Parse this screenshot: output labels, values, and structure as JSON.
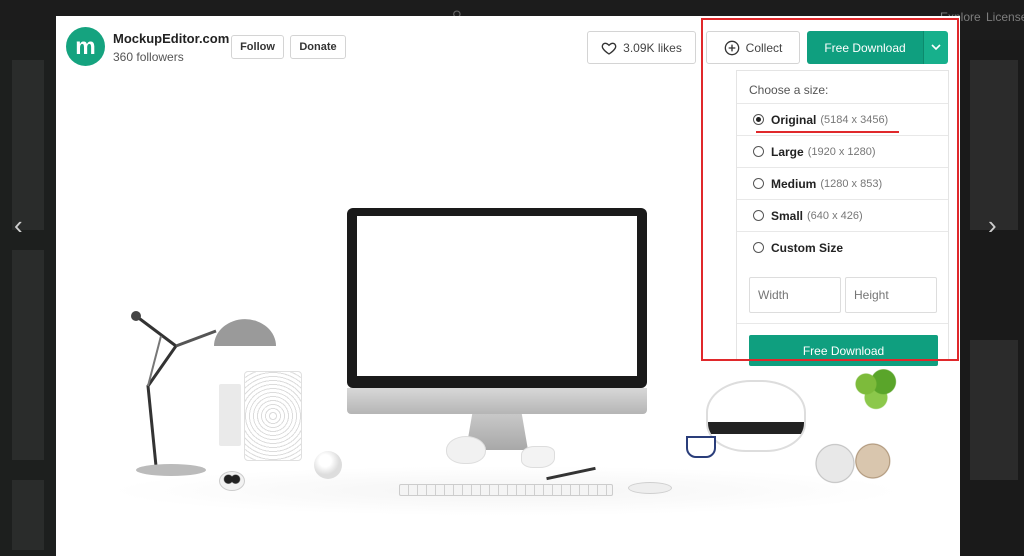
{
  "background": {
    "top_right_items": [
      "Explore",
      "License"
    ],
    "left_arrow": "‹",
    "right_arrow": "›"
  },
  "author": {
    "avatar_letter": "m",
    "name": "MockupEditor.com",
    "followers": "360 followers",
    "follow_label": "Follow",
    "donate_label": "Donate"
  },
  "actions": {
    "likes_label": "3.09K likes",
    "collect_label": "Collect",
    "download_label": "Free Download",
    "caret_icon": "chevron-down-icon"
  },
  "download_menu": {
    "title": "Choose a size:",
    "sizes": [
      {
        "label": "Original",
        "dimensions": "(5184 x 3456)",
        "selected": true
      },
      {
        "label": "Large",
        "dimensions": "(1920 x 1280)",
        "selected": false
      },
      {
        "label": "Medium",
        "dimensions": "(1280 x 853)",
        "selected": false
      },
      {
        "label": "Small",
        "dimensions": "(640 x 426)",
        "selected": false
      }
    ],
    "custom_label": "Custom Size",
    "width_placeholder": "Width",
    "height_placeholder": "Height",
    "download_label": "Free Download"
  },
  "colors": {
    "accent": "#0f9f7f",
    "annotation": "#e0282b"
  }
}
